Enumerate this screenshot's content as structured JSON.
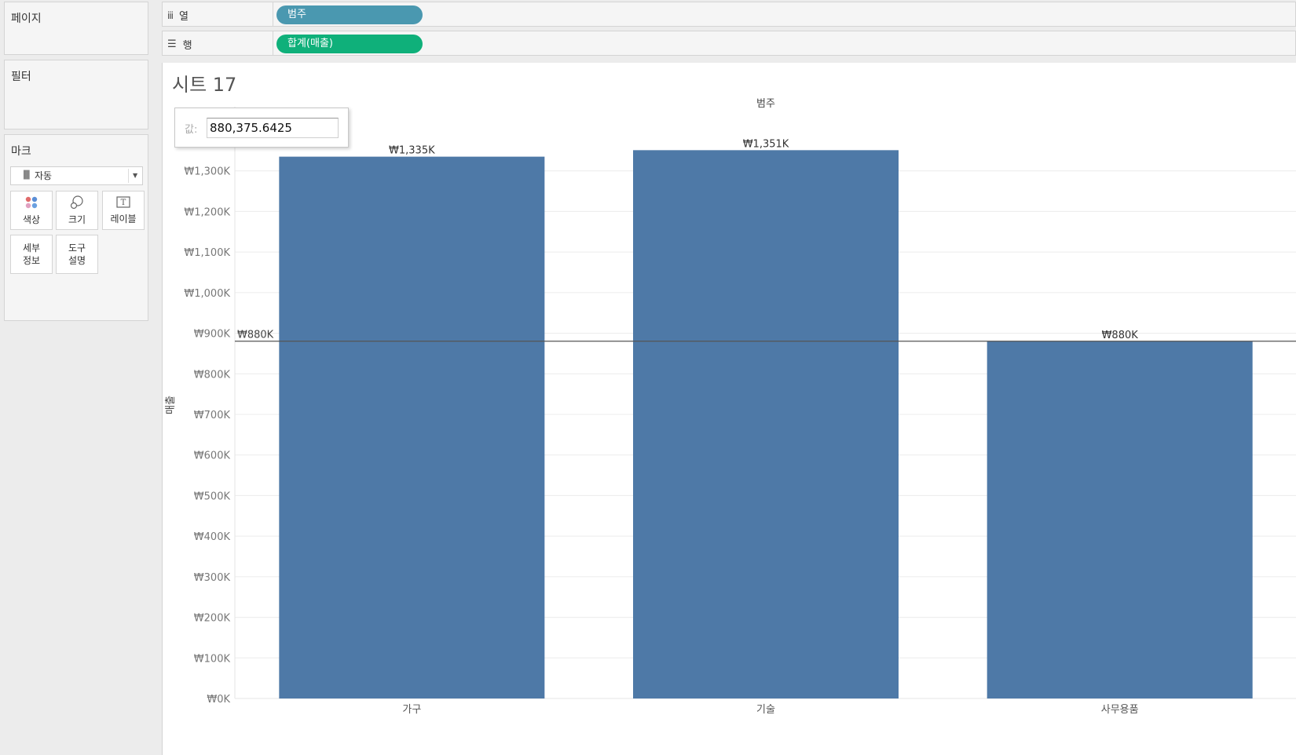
{
  "shelves": {
    "pages_label": "페이지",
    "filters_label": "필터",
    "marks_label": "마크",
    "columns": {
      "icon": "columns-icon",
      "label": "열",
      "pill": "범주",
      "pill_color": "#4a98b0"
    },
    "rows": {
      "icon": "rows-icon",
      "label": "행",
      "pill": "합계(매출)",
      "pill_color": "#0fb07a"
    }
  },
  "marks": {
    "type": "자동",
    "buttons": [
      {
        "label": "색상",
        "icon": "color-icon"
      },
      {
        "label": "크기",
        "icon": "size-icon"
      },
      {
        "label": "레이블",
        "icon": "label-icon"
      },
      {
        "label": "세부\n정보",
        "icon": "detail-icon"
      },
      {
        "label": "도구\n설명",
        "icon": "tooltip-icon"
      }
    ]
  },
  "sheet": {
    "title": "시트 17"
  },
  "tooltip": {
    "label": "값:",
    "value": "880,375.6425"
  },
  "chart_data": {
    "type": "bar",
    "title": "",
    "header": "범주",
    "ylabel": "매출",
    "categories": [
      "가구",
      "기술",
      "사무용품"
    ],
    "values": [
      1335,
      1351,
      880
    ],
    "value_labels": [
      "₩1,335K",
      "₩1,351K",
      "₩880K"
    ],
    "ylim": [
      0,
      1400
    ],
    "yticks": [
      0,
      100,
      200,
      300,
      400,
      500,
      600,
      700,
      800,
      900,
      1000,
      1100,
      1200,
      1300
    ],
    "ytick_labels": [
      "₩0K",
      "₩100K",
      "₩200K",
      "₩300K",
      "₩400K",
      "₩500K",
      "₩600K",
      "₩700K",
      "₩800K",
      "₩900K",
      "₩1,000K",
      "₩1,100K",
      "₩1,200K",
      "₩1,300K"
    ],
    "reference_line": {
      "value": 880.3756425,
      "label": "₩880K"
    },
    "bar_color": "#4e79a7",
    "grid": true
  }
}
